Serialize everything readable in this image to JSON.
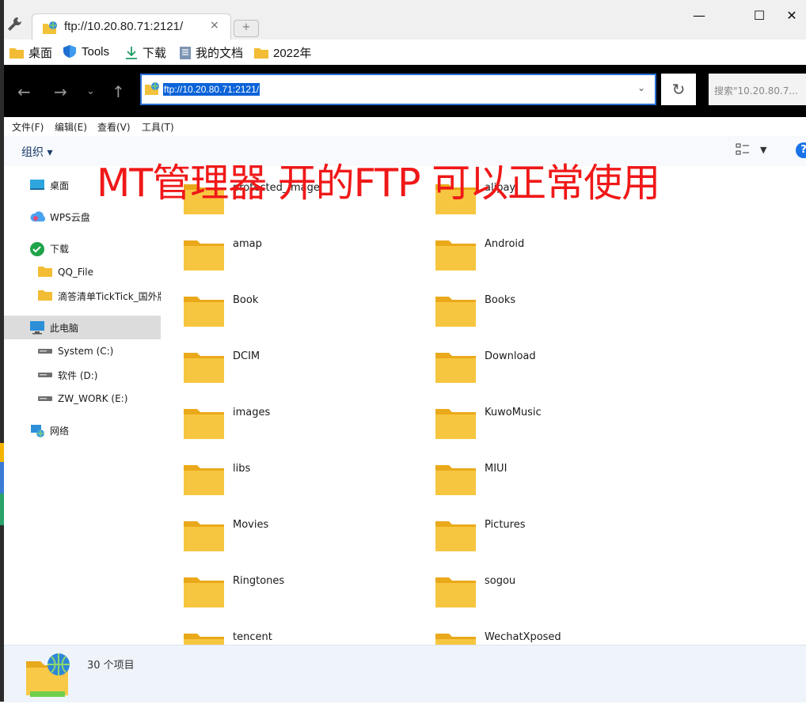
{
  "browser": {
    "tab_title": "ftp://10.20.80.71:2121/",
    "tab_close": "×",
    "new_tab": "+",
    "window_buttons": {
      "minimize": "—",
      "maximize": "☐",
      "close": "✕"
    }
  },
  "bookmarks": [
    {
      "label": "桌面",
      "icon": "folder-icon"
    },
    {
      "label": "Tools",
      "icon": "shield-icon"
    },
    {
      "label": "下载",
      "icon": "download-icon"
    },
    {
      "label": "我的文档",
      "icon": "document-icon"
    },
    {
      "label": "2022年",
      "icon": "folder-icon"
    }
  ],
  "address_bar": {
    "url": "ftp://10.20.80.71:2121/",
    "search_placeholder": "搜索\"10.20.80.7..."
  },
  "menu": [
    "文件(F)",
    "编辑(E)",
    "查看(V)",
    "工具(T)"
  ],
  "toolbar": {
    "organize": "组织 ▾",
    "help": "?"
  },
  "sidebar": [
    {
      "label": "桌面",
      "icon": "desktop-icon"
    },
    {
      "label": "WPS云盘",
      "icon": "cloud-icon"
    },
    {
      "label": "下载",
      "icon": "download-check-icon"
    },
    {
      "label": "QQ_File",
      "icon": "folder-icon"
    },
    {
      "label": "滴答清单TickTick_国外版",
      "icon": "folder-icon"
    },
    {
      "label": "此电脑",
      "icon": "computer-icon",
      "selected": true
    },
    {
      "label": "System (C:)",
      "icon": "drive-icon"
    },
    {
      "label": "软件 (D:)",
      "icon": "drive-icon"
    },
    {
      "label": "ZW_WORK (E:)",
      "icon": "drive-icon"
    },
    {
      "label": "网络",
      "icon": "network-icon"
    }
  ],
  "folders": [
    "protected_image",
    "alipay",
    "amap",
    "Android",
    "Book",
    "Books",
    "DCIM",
    "Download",
    "images",
    "KuwoMusic",
    "libs",
    "MIUI",
    "Movies",
    "Pictures",
    "Ringtones",
    "sogou",
    "tencent",
    "WechatXposed"
  ],
  "status": {
    "count": "30 个项目"
  },
  "annotation": "MT管理器 开的FTP 可以正常使用",
  "colors": {
    "folder": "#f7c640",
    "folder_back": "#eaa91a",
    "annotation": "#f01818",
    "selection": "#0a63d8"
  }
}
